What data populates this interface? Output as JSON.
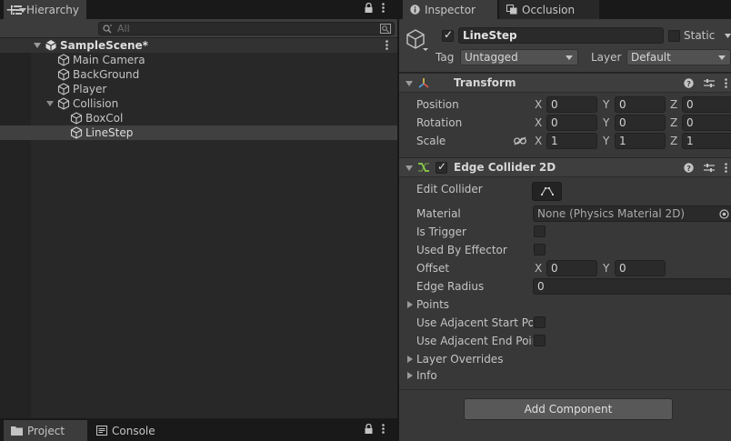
{
  "hierarchy": {
    "tab_label": "Hierarchy",
    "search_placeholder": "All",
    "add_symbol": "+",
    "tree": [
      {
        "label": "SampleScene*",
        "kind": "scene"
      },
      {
        "label": "Main Camera",
        "kind": "object"
      },
      {
        "label": "BackGround",
        "kind": "object"
      },
      {
        "label": "Player",
        "kind": "object"
      },
      {
        "label": "Collision",
        "kind": "object",
        "expanded": true
      },
      {
        "label": "BoxCol",
        "kind": "child"
      },
      {
        "label": "LineStep",
        "kind": "child",
        "selected": true
      }
    ]
  },
  "bottom_tabs": {
    "project": "Project",
    "console": "Console"
  },
  "inspector": {
    "tabs": {
      "inspector": "Inspector",
      "occlusion": "Occlusion"
    },
    "object": {
      "name": "LineStep",
      "active": true,
      "static_label": "Static",
      "static": false,
      "tag_label": "Tag",
      "tag_value": "Untagged",
      "layer_label": "Layer",
      "layer_value": "Default"
    },
    "transform": {
      "title": "Transform",
      "position_label": "Position",
      "rotation_label": "Rotation",
      "scale_label": "Scale",
      "axes": {
        "x": "X",
        "y": "Y",
        "z": "Z"
      },
      "position": {
        "x": "0",
        "y": "0",
        "z": "0"
      },
      "rotation": {
        "x": "0",
        "y": "0",
        "z": "0"
      },
      "scale": {
        "x": "1",
        "y": "1",
        "z": "1"
      }
    },
    "edge_collider": {
      "title": "Edge Collider 2D",
      "enabled": true,
      "edit_collider_label": "Edit Collider",
      "material_label": "Material",
      "material_value": "None (Physics Material 2D)",
      "is_trigger_label": "Is Trigger",
      "used_by_effector_label": "Used By Effector",
      "offset_label": "Offset",
      "offset": {
        "x": "0",
        "y": "0"
      },
      "edge_radius_label": "Edge Radius",
      "edge_radius_value": "0",
      "points_label": "Points",
      "use_adjacent_start_label": "Use Adjacent Start Poi",
      "use_adjacent_end_label": "Use Adjacent End Poin",
      "layer_overrides_label": "Layer Overrides",
      "info_label": "Info"
    },
    "add_component_label": "Add Component"
  },
  "colors": {
    "panel_dark": "#191919",
    "panel": "#282828",
    "inspector_bg": "#383838",
    "selection": "#404040",
    "transform_icon": "#4aa6e8",
    "collider_icon": "#8bd14a"
  }
}
